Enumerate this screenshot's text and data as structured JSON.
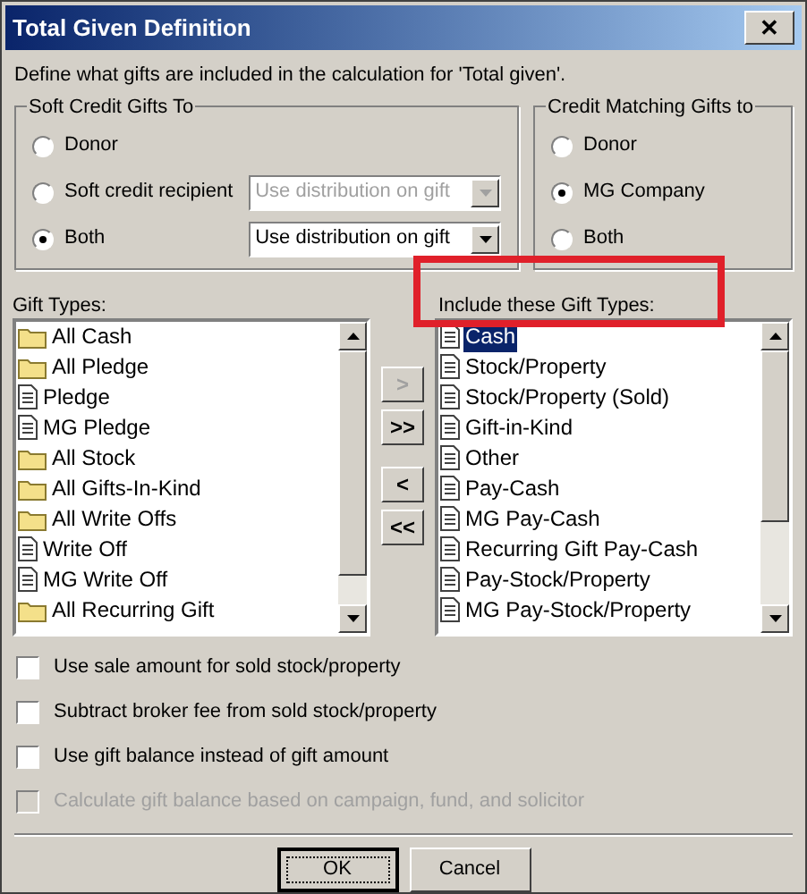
{
  "window": {
    "title": "Total Given Definition",
    "close": "✕"
  },
  "description": "Define what gifts are included in the calculation for 'Total given'.",
  "soft_credit": {
    "title": "Soft Credit Gifts To",
    "options": [
      {
        "label": "Donor",
        "selected": false
      },
      {
        "label": "Soft credit recipient",
        "selected": false,
        "dropdown": {
          "value": "Use distribution on gift",
          "disabled": true
        }
      },
      {
        "label": "Both",
        "selected": true,
        "dropdown": {
          "value": "Use distribution on gift",
          "disabled": false
        }
      }
    ]
  },
  "matching": {
    "title": "Credit Matching Gifts to",
    "options": [
      {
        "label": "Donor",
        "selected": false
      },
      {
        "label": "MG Company",
        "selected": true
      },
      {
        "label": "Both",
        "selected": false
      }
    ]
  },
  "gift_types": {
    "label": "Gift Types:",
    "items": [
      {
        "label": "All Cash",
        "kind": "folder",
        "selected": false
      },
      {
        "label": "All Pledge",
        "kind": "folder",
        "selected": false
      },
      {
        "label": "Pledge",
        "kind": "document",
        "selected": false
      },
      {
        "label": "MG Pledge",
        "kind": "document",
        "selected": false
      },
      {
        "label": "All Stock",
        "kind": "folder",
        "selected": false
      },
      {
        "label": "All Gifts-In-Kind",
        "kind": "folder",
        "selected": false
      },
      {
        "label": "All Write Offs",
        "kind": "folder",
        "selected": false
      },
      {
        "label": "Write Off",
        "kind": "document",
        "selected": false
      },
      {
        "label": "MG Write Off",
        "kind": "document",
        "selected": false
      },
      {
        "label": "All Recurring Gift",
        "kind": "folder",
        "selected": false
      }
    ]
  },
  "move_buttons": [
    {
      "label": ">",
      "disabled": true
    },
    {
      "label": ">>",
      "disabled": false
    },
    {
      "label": "<",
      "disabled": false
    },
    {
      "label": "<<",
      "disabled": false
    }
  ],
  "included": {
    "label": "Include these Gift Types:",
    "highlighted": true,
    "items": [
      {
        "label": "Cash",
        "kind": "document",
        "selected": true
      },
      {
        "label": "Stock/Property",
        "kind": "document",
        "selected": false
      },
      {
        "label": "Stock/Property (Sold)",
        "kind": "document",
        "selected": false
      },
      {
        "label": "Gift-in-Kind",
        "kind": "document",
        "selected": false
      },
      {
        "label": "Other",
        "kind": "document",
        "selected": false
      },
      {
        "label": "Pay-Cash",
        "kind": "document",
        "selected": false
      },
      {
        "label": "MG Pay-Cash",
        "kind": "document",
        "selected": false
      },
      {
        "label": "Recurring Gift Pay-Cash",
        "kind": "document",
        "selected": false
      },
      {
        "label": "Pay-Stock/Property",
        "kind": "document",
        "selected": false
      },
      {
        "label": "MG Pay-Stock/Property",
        "kind": "document",
        "selected": false
      }
    ]
  },
  "options": [
    {
      "label": "Use sale amount for sold stock/property",
      "checked": false,
      "disabled": false
    },
    {
      "label": "Subtract broker fee from sold stock/property",
      "checked": false,
      "disabled": false
    },
    {
      "label": "Use gift balance instead of gift amount",
      "checked": false,
      "disabled": false
    },
    {
      "label": "Calculate gift balance based on campaign, fund, and solicitor",
      "checked": false,
      "disabled": true
    }
  ],
  "buttons": [
    {
      "label": "OK",
      "default": true
    },
    {
      "label": "Cancel",
      "default": false
    }
  ]
}
